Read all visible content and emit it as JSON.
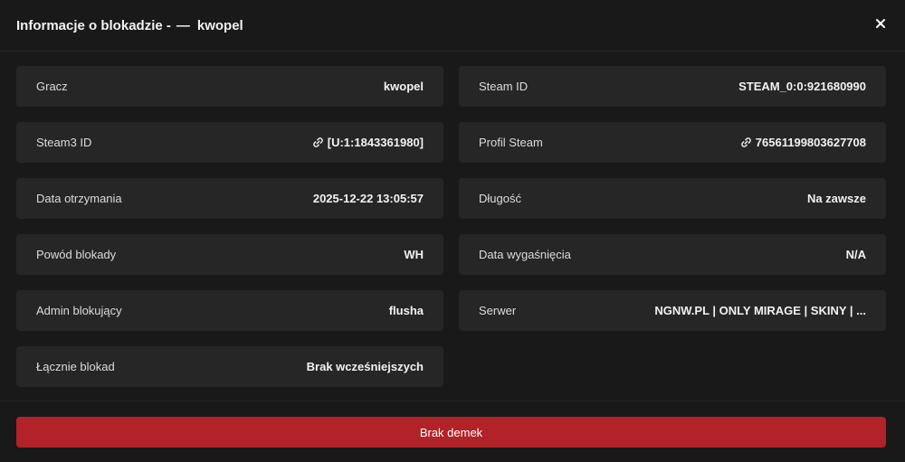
{
  "header": {
    "title_prefix": "Informacje o blokadzie -",
    "dash": "—",
    "player_name": "kwopel",
    "close_glyph": "×"
  },
  "rows": [
    {
      "label": "Gracz",
      "value": "kwopel",
      "icon": null
    },
    {
      "label": "Steam ID",
      "value": "STEAM_0:0:921680990",
      "icon": null
    },
    {
      "label": "Steam3 ID",
      "value": "[U:1:1843361980]",
      "icon": "link-icon"
    },
    {
      "label": "Profil Steam",
      "value": "76561199803627708",
      "icon": "link-icon"
    },
    {
      "label": "Data otrzymania",
      "value": "2025-12-22 13:05:57",
      "icon": null
    },
    {
      "label": "Długość",
      "value": "Na zawsze",
      "icon": null
    },
    {
      "label": "Powód blokady",
      "value": "WH",
      "icon": null
    },
    {
      "label": "Data wygaśnięcia",
      "value": "N/A",
      "icon": null
    },
    {
      "label": "Admin blokujący",
      "value": "flusha",
      "icon": null
    },
    {
      "label": "Serwer",
      "value": "NGNW.PL | ONLY MIRAGE | SKINY | ...",
      "icon": null
    },
    {
      "label": "Łącznie blokad",
      "value": "Brak wcześniejszych",
      "icon": null
    }
  ],
  "footer": {
    "demo_button_label": "Brak demek"
  },
  "colors": {
    "background": "#191919",
    "row_background": "#262626",
    "accent_red": "#b22229",
    "text": "#f2f2f2"
  }
}
